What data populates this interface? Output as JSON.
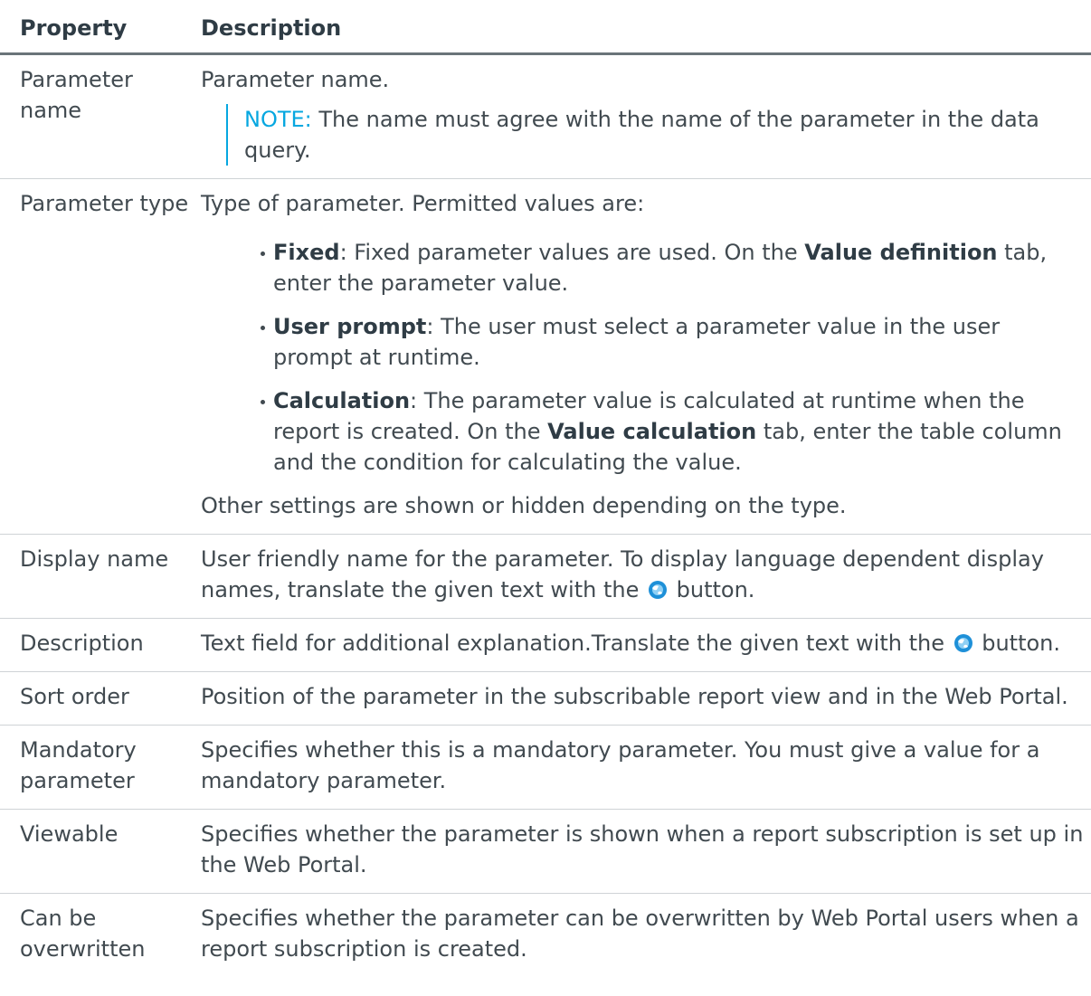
{
  "header": {
    "property": "Property",
    "description": "Description"
  },
  "rows": {
    "param_name": {
      "label": "Parameter name",
      "text": "Parameter name.",
      "note_label": "NOTE:",
      "note_text": " The name must agree with the name of the parameter in the data query."
    },
    "param_type": {
      "label": "Parameter type",
      "intro": "Type of parameter. Permitted values are:",
      "items": [
        {
          "term": "Fixed",
          "text_a": ": Fixed parameter values are used. On the ",
          "tab": "Value definition",
          "text_b": " tab, enter the parameter value."
        },
        {
          "term": "User prompt",
          "text_a": ": The user must select a parameter value in the user prompt at runtime."
        },
        {
          "term": "Calculation",
          "text_a": ": The parameter value is calculated at runtime when the report is created. On the ",
          "tab": "Value calculation",
          "text_b": " tab, enter the table column and the condition for calculating the value."
        }
      ],
      "outro": "Other settings are shown or hidden depending on the type."
    },
    "display_name": {
      "label": "Display name",
      "text_a": "User friendly name for the parameter. To display language dependent display names, translate the given text with the ",
      "text_b": " button."
    },
    "description": {
      "label": "Description",
      "text_a": "Text field for additional explanation.Translate the given text with the ",
      "text_b": "button."
    },
    "sort_order": {
      "label": "Sort order",
      "text": "Position of the parameter in the subscribable report view and in the Web Portal."
    },
    "mandatory": {
      "label": "Mandatory parameter",
      "text": "Specifies whether this is a mandatory parameter. You must give a value for a mandatory parameter."
    },
    "viewable": {
      "label": "Viewable",
      "text": "Specifies whether the parameter is shown when a report subscription is set up in the Web Portal."
    },
    "overwrite": {
      "label": "Can be overwritten",
      "text": "Specifies whether the parameter can be overwritten by Web Portal users when a report subscription is created."
    }
  },
  "icons": {
    "translate": "globe-translate-icon"
  },
  "colors": {
    "text": "#414a50",
    "heading": "#2f3c45",
    "note": "#06a7e0",
    "header_rule": "#6a7479",
    "row_rule": "#cfd3d6"
  }
}
